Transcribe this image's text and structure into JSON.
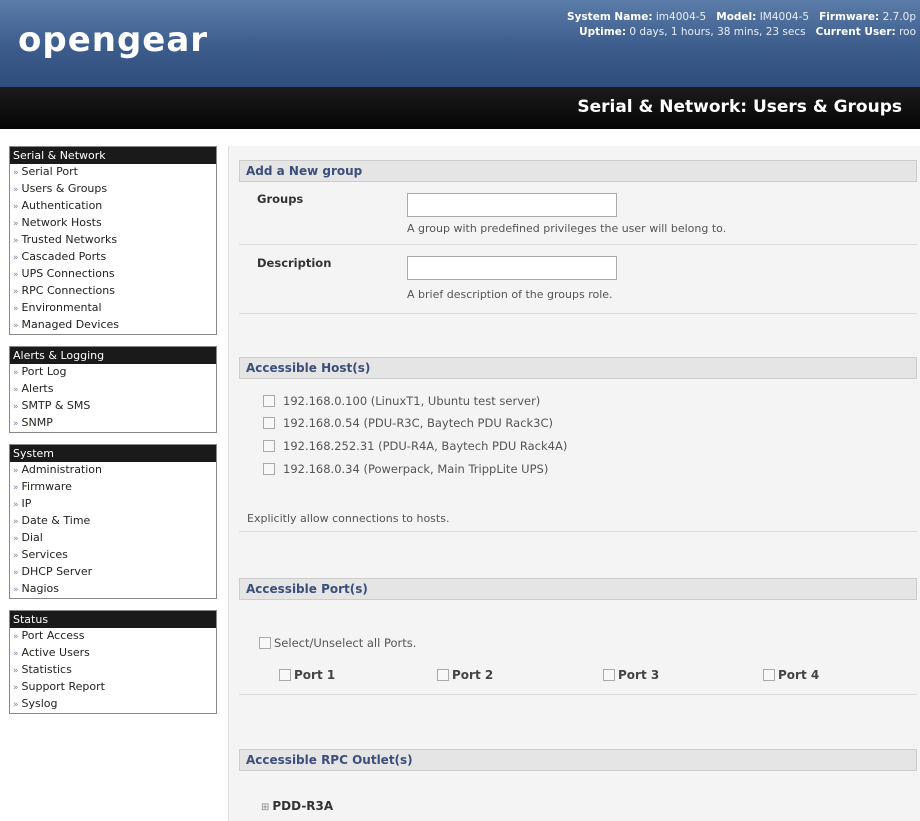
{
  "header": {
    "logo": "opengear",
    "system_name_label": "System Name:",
    "system_name": "im4004-5",
    "model_label": "Model:",
    "model": "IM4004-5",
    "firmware_label": "Firmware:",
    "firmware": "2.7.0p",
    "uptime_label": "Uptime:",
    "uptime": "0 days, 1 hours, 38 mins, 23 secs",
    "current_user_label": "Current User:",
    "current_user": "roo",
    "page_title": "Serial & Network: Users & Groups"
  },
  "sidebar": {
    "serial_network": {
      "title": "Serial & Network",
      "items": [
        "Serial Port",
        "Users & Groups",
        "Authentication",
        "Network Hosts",
        "Trusted Networks",
        "Cascaded Ports",
        "UPS Connections",
        "RPC Connections",
        "Environmental",
        "Managed Devices"
      ]
    },
    "alerts_logging": {
      "title": "Alerts & Logging",
      "items": [
        "Port Log",
        "Alerts",
        "SMTP & SMS",
        "SNMP"
      ]
    },
    "system": {
      "title": "System",
      "items": [
        "Administration",
        "Firmware",
        "IP",
        "Date & Time",
        "Dial",
        "Services",
        "DHCP Server",
        "Nagios"
      ]
    },
    "status": {
      "title": "Status",
      "items": [
        "Port Access",
        "Active Users",
        "Statistics",
        "Support Report",
        "Syslog"
      ]
    }
  },
  "add_group": {
    "title": "Add a New group",
    "groups_label": "Groups",
    "groups_value": "",
    "groups_hint": "A group with predefined privileges the user will belong to.",
    "description_label": "Description",
    "description_value": "",
    "description_hint": "A brief description of the groups role."
  },
  "hosts": {
    "title": "Accessible Host(s)",
    "items": [
      "192.168.0.100 (LinuxT1, Ubuntu test server)",
      "192.168.0.54 (PDU-R3C, Baytech PDU Rack3C)",
      "192.168.252.31 (PDU-R4A, Baytech PDU Rack4A)",
      "192.168.0.34 (Powerpack, Main TrippLite UPS)"
    ],
    "hint": "Explicitly allow connections to hosts."
  },
  "ports": {
    "title": "Accessible Port(s)",
    "select_all": "Select/Unselect all Ports.",
    "items": [
      "Port 1",
      "Port 2",
      "Port 3",
      "Port 4"
    ]
  },
  "rpc": {
    "title": "Accessible RPC Outlet(s)",
    "pdu": "PDD-R3A",
    "expand_glyph": "⊞"
  }
}
